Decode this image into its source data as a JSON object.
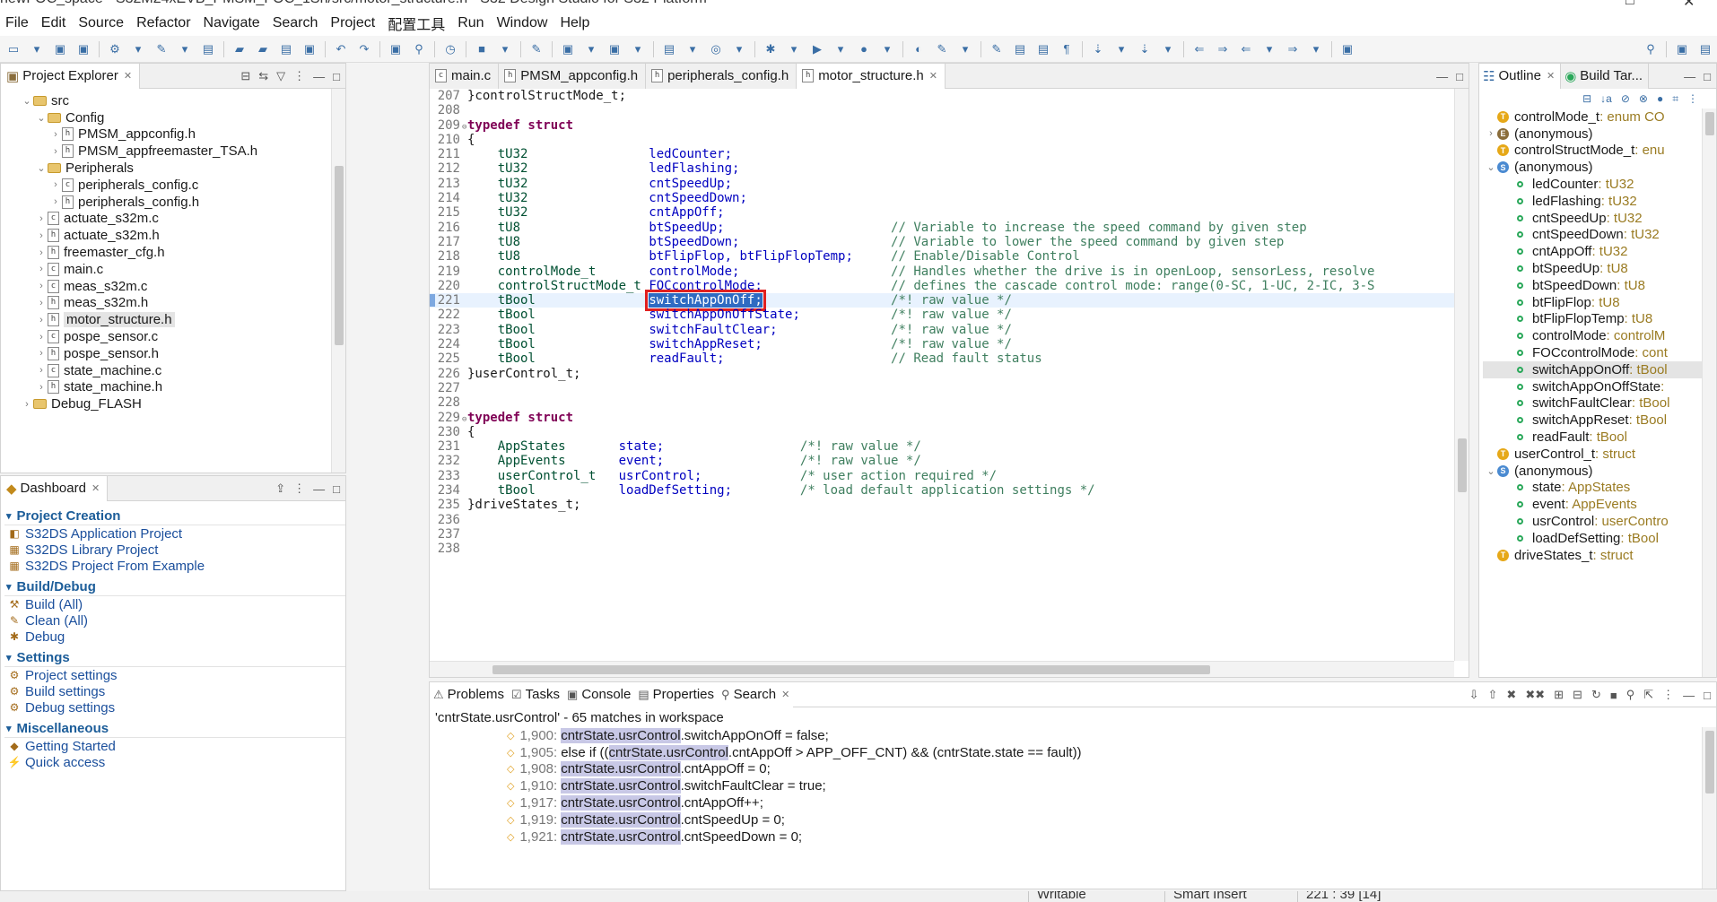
{
  "window": {
    "title": "newFOC_space - S32M24xEVB_PMSM_FOC_1Sh/src/motor_structure.h - S32 Design Studio for S32 Platform"
  },
  "menu": [
    "File",
    "Edit",
    "Source",
    "Refactor",
    "Navigate",
    "Search",
    "Project",
    "配置工具",
    "Run",
    "Window",
    "Help"
  ],
  "project_explorer": {
    "tab_label": "Project Explorer",
    "items": [
      {
        "label": "src",
        "depth": 1,
        "kind": "folder",
        "state": "open"
      },
      {
        "label": "Config",
        "depth": 2,
        "kind": "folder",
        "state": "open"
      },
      {
        "label": "PMSM_appconfig.h",
        "depth": 3,
        "kind": "h",
        "state": "closed"
      },
      {
        "label": "PMSM_appfreemaster_TSA.h",
        "depth": 3,
        "kind": "h",
        "state": "closed"
      },
      {
        "label": "Peripherals",
        "depth": 2,
        "kind": "folder",
        "state": "open"
      },
      {
        "label": "peripherals_config.c",
        "depth": 3,
        "kind": "c",
        "state": "closed"
      },
      {
        "label": "peripherals_config.h",
        "depth": 3,
        "kind": "h",
        "state": "closed"
      },
      {
        "label": "actuate_s32m.c",
        "depth": 2,
        "kind": "c",
        "state": "closed"
      },
      {
        "label": "actuate_s32m.h",
        "depth": 2,
        "kind": "h",
        "state": "closed"
      },
      {
        "label": "freemaster_cfg.h",
        "depth": 2,
        "kind": "h",
        "state": "closed"
      },
      {
        "label": "main.c",
        "depth": 2,
        "kind": "c",
        "state": "closed"
      },
      {
        "label": "meas_s32m.c",
        "depth": 2,
        "kind": "c",
        "state": "closed"
      },
      {
        "label": "meas_s32m.h",
        "depth": 2,
        "kind": "h",
        "state": "closed"
      },
      {
        "label": "motor_structure.h",
        "depth": 2,
        "kind": "h",
        "state": "closed",
        "selected": true
      },
      {
        "label": "pospe_sensor.c",
        "depth": 2,
        "kind": "c",
        "state": "closed"
      },
      {
        "label": "pospe_sensor.h",
        "depth": 2,
        "kind": "h",
        "state": "closed"
      },
      {
        "label": "state_machine.c",
        "depth": 2,
        "kind": "c",
        "state": "closed"
      },
      {
        "label": "state_machine.h",
        "depth": 2,
        "kind": "h",
        "state": "closed"
      },
      {
        "label": "Debug_FLASH",
        "depth": 1,
        "kind": "folder",
        "state": "closed"
      }
    ]
  },
  "dashboard": {
    "tab_label": "Dashboard",
    "sections": [
      {
        "title": "Project Creation",
        "links": [
          "S32DS Application Project",
          "S32DS Library Project",
          "S32DS Project From Example"
        ]
      },
      {
        "title": "Build/Debug",
        "links": [
          "Build  (All)",
          "Clean  (All)",
          "Debug"
        ]
      },
      {
        "title": "Settings",
        "links": [
          "Project settings",
          "Build settings",
          "Debug settings"
        ]
      },
      {
        "title": "Miscellaneous",
        "links": [
          "Getting Started",
          "Quick access"
        ]
      }
    ]
  },
  "editor": {
    "tabs": [
      {
        "label": "main.c",
        "active": false
      },
      {
        "label": "PMSM_appconfig.h",
        "active": false
      },
      {
        "label": "peripherals_config.h",
        "active": false
      },
      {
        "label": "motor_structure.h",
        "active": true
      }
    ],
    "lines": [
      {
        "n": "207",
        "kind": "plain",
        "text": "}controlStructMode_t;"
      },
      {
        "n": "208",
        "kind": "plain",
        "text": ""
      },
      {
        "n": "209",
        "kind": "typedef",
        "text": "typedef struct"
      },
      {
        "n": "210",
        "kind": "plain",
        "text": "{"
      },
      {
        "n": "211",
        "kind": "decl",
        "type": "tU32",
        "name": "ledCounter;",
        "comment": ""
      },
      {
        "n": "212",
        "kind": "decl",
        "type": "tU32",
        "name": "ledFlashing;",
        "comment": ""
      },
      {
        "n": "213",
        "kind": "decl",
        "type": "tU32",
        "name": "cntSpeedUp;",
        "comment": ""
      },
      {
        "n": "214",
        "kind": "decl",
        "type": "tU32",
        "name": "cntSpeedDown;",
        "comment": ""
      },
      {
        "n": "215",
        "kind": "decl",
        "type": "tU32",
        "name": "cntAppOff;",
        "comment": ""
      },
      {
        "n": "216",
        "kind": "decl",
        "type": "tU8",
        "name": "btSpeedUp;",
        "comment": "// Variable to increase the speed command by given step"
      },
      {
        "n": "217",
        "kind": "decl",
        "type": "tU8",
        "name": "btSpeedDown;",
        "comment": "// Variable to lower the speed command by given step"
      },
      {
        "n": "218",
        "kind": "decl",
        "type": "tU8",
        "name": "btFlipFlop, btFlipFlopTemp;",
        "comment": "// Enable/Disable Control"
      },
      {
        "n": "219",
        "kind": "decl",
        "type": "controlMode_t",
        "name": "controlMode;",
        "comment": "// Handles whether the drive is in openLoop, sensorLess, resolve"
      },
      {
        "n": "220",
        "kind": "decl",
        "type": "controlStructMode_t",
        "name": "FOCcontrolMode;",
        "comment": "// defines the cascade control mode: range(0-SC, 1-UC, 2-IC, 3-S"
      },
      {
        "n": "221",
        "kind": "decl",
        "type": "tBool",
        "name": "switchAppOnOff;",
        "comment": "/*! raw value */",
        "highlight": true
      },
      {
        "n": "222",
        "kind": "decl",
        "type": "tBool",
        "name": "switchAppOnOffState;",
        "comment": "/*! raw value */"
      },
      {
        "n": "223",
        "kind": "decl",
        "type": "tBool",
        "name": "switchFaultClear;",
        "comment": "/*! raw value */"
      },
      {
        "n": "224",
        "kind": "decl",
        "type": "tBool",
        "name": "switchAppReset;",
        "comment": "/*! raw value */"
      },
      {
        "n": "225",
        "kind": "decl",
        "type": "tBool",
        "name": "readFault;",
        "comment": "// Read fault status"
      },
      {
        "n": "226",
        "kind": "plain",
        "text": "}userControl_t;"
      },
      {
        "n": "227",
        "kind": "plain",
        "text": ""
      },
      {
        "n": "228",
        "kind": "plain",
        "text": ""
      },
      {
        "n": "229",
        "kind": "typedef",
        "text": "typedef struct"
      },
      {
        "n": "230",
        "kind": "plain",
        "text": "{"
      },
      {
        "n": "231",
        "kind": "decl2",
        "type": "AppStates",
        "name": "state;",
        "comment": "/*! raw value */"
      },
      {
        "n": "232",
        "kind": "decl2",
        "type": "AppEvents",
        "name": "event;",
        "comment": "/*! raw value */"
      },
      {
        "n": "233",
        "kind": "decl2",
        "type": "userControl_t",
        "name": "usrControl;",
        "comment": "/* user action required */"
      },
      {
        "n": "234",
        "kind": "decl2",
        "type": "tBool",
        "name": "loadDefSetting;",
        "comment": "/* load default application settings */"
      },
      {
        "n": "235",
        "kind": "plain",
        "text": "}driveStates_t;"
      },
      {
        "n": "236",
        "kind": "plain",
        "text": ""
      },
      {
        "n": "237",
        "kind": "plain",
        "text": ""
      },
      {
        "n": "238",
        "kind": "plain",
        "text": ""
      }
    ]
  },
  "outline": {
    "tabs": [
      "Outline",
      "Build Tar..."
    ],
    "items": [
      {
        "icon": "t",
        "name": "controlMode_t",
        "type": " : enum CO",
        "depth": 0
      },
      {
        "icon": "e",
        "name": "(anonymous)",
        "type": "",
        "depth": 0,
        "twisty": ">"
      },
      {
        "icon": "t",
        "name": "controlStructMode_t",
        "type": " : enu",
        "depth": 0
      },
      {
        "icon": "s",
        "name": "(anonymous)",
        "type": "",
        "depth": 0,
        "twisty": "v"
      },
      {
        "icon": "f",
        "name": "ledCounter",
        "type": " : tU32",
        "depth": 1
      },
      {
        "icon": "f",
        "name": "ledFlashing",
        "type": " : tU32",
        "depth": 1
      },
      {
        "icon": "f",
        "name": "cntSpeedUp",
        "type": " : tU32",
        "depth": 1
      },
      {
        "icon": "f",
        "name": "cntSpeedDown",
        "type": " : tU32",
        "depth": 1
      },
      {
        "icon": "f",
        "name": "cntAppOff",
        "type": " : tU32",
        "depth": 1
      },
      {
        "icon": "f",
        "name": "btSpeedUp",
        "type": " : tU8",
        "depth": 1
      },
      {
        "icon": "f",
        "name": "btSpeedDown",
        "type": " : tU8",
        "depth": 1
      },
      {
        "icon": "f",
        "name": "btFlipFlop",
        "type": " : tU8",
        "depth": 1
      },
      {
        "icon": "f",
        "name": "btFlipFlopTemp",
        "type": " : tU8",
        "depth": 1
      },
      {
        "icon": "f",
        "name": "controlMode",
        "type": " : controlM",
        "depth": 1
      },
      {
        "icon": "f",
        "name": "FOCcontrolMode",
        "type": " : cont",
        "depth": 1
      },
      {
        "icon": "f",
        "name": "switchAppOnOff",
        "type": " : tBool",
        "depth": 1,
        "selected": true
      },
      {
        "icon": "f",
        "name": "switchAppOnOffState",
        "type": " :",
        "depth": 1
      },
      {
        "icon": "f",
        "name": "switchFaultClear",
        "type": " : tBool",
        "depth": 1
      },
      {
        "icon": "f",
        "name": "switchAppReset",
        "type": " : tBool",
        "depth": 1
      },
      {
        "icon": "f",
        "name": "readFault",
        "type": " : tBool",
        "depth": 1
      },
      {
        "icon": "t",
        "name": "userControl_t",
        "type": " : struct",
        "depth": 0
      },
      {
        "icon": "s",
        "name": "(anonymous)",
        "type": "",
        "depth": 0,
        "twisty": "v"
      },
      {
        "icon": "f",
        "name": "state",
        "type": " : AppStates",
        "depth": 1
      },
      {
        "icon": "f",
        "name": "event",
        "type": " : AppEvents",
        "depth": 1
      },
      {
        "icon": "f",
        "name": "usrControl",
        "type": " : userContro",
        "depth": 1
      },
      {
        "icon": "f",
        "name": "loadDefSetting",
        "type": " : tBool",
        "depth": 1
      },
      {
        "icon": "t",
        "name": "driveStates_t",
        "type": " : struct",
        "depth": 0
      }
    ]
  },
  "bottom": {
    "tabs": [
      {
        "label": "Problems",
        "active": false
      },
      {
        "label": "Tasks",
        "active": false
      },
      {
        "label": "Console",
        "active": false
      },
      {
        "label": "Properties",
        "active": false
      },
      {
        "label": "Search",
        "active": true
      }
    ],
    "summary": "'cntrState.usrControl' - 65 matches in workspace",
    "matches": [
      {
        "line": "1,900:",
        "pre": "",
        "hit": "cntrState.usrControl",
        "post": ".switchAppOnOff = false;"
      },
      {
        "line": "1,905:",
        "pre": "else if ((",
        "hit": "cntrState.usrControl",
        "post": ".cntAppOff > APP_OFF_CNT) && (cntrState.state == fault))"
      },
      {
        "line": "1,908:",
        "pre": "",
        "hit": "cntrState.usrControl",
        "post": ".cntAppOff = 0;"
      },
      {
        "line": "1,910:",
        "pre": "",
        "hit": "cntrState.usrControl",
        "post": ".switchFaultClear = true;"
      },
      {
        "line": "1,917:",
        "pre": "",
        "hit": "cntrState.usrControl",
        "post": ".cntAppOff++;"
      },
      {
        "line": "1,919:",
        "pre": "",
        "hit": "cntrState.usrControl",
        "post": ".cntSpeedUp = 0;"
      },
      {
        "line": "1,921:",
        "pre": "",
        "hit": "cntrState.usrControl",
        "post": ".cntSpeedDown = 0;"
      }
    ]
  },
  "status": {
    "writable": "Writable",
    "insert_mode": "Smart Insert",
    "position": "221 : 39 [14]"
  }
}
